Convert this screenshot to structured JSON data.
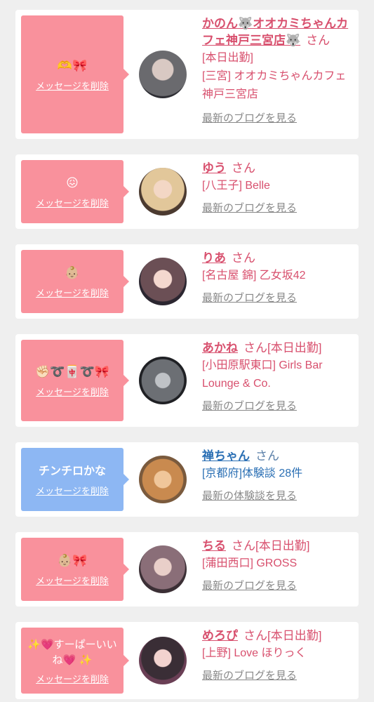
{
  "items": [
    {
      "bubble_message": "🫶🎀",
      "delete_label": "メッセージを削除",
      "name": "かのん🐺オオカミちゃんカフェ神戸三宮店🐺",
      "honorific": "さん",
      "status": "[本日出勤]",
      "shop": "[三宮] オオカミちゃんカフェ神戸三宮店",
      "link": "最新のブログを見る"
    },
    {
      "bubble_message": "😖",
      "delete_label": "メッセージを削除",
      "name": "ゆう",
      "honorific": "さん",
      "status": "",
      "shop": "[八王子] Belle",
      "link": "最新のブログを見る"
    },
    {
      "bubble_message": "👶🏼",
      "delete_label": "メッセージを削除",
      "name": "りあ",
      "honorific": "さん",
      "status": "",
      "shop": "[名古屋 錦] 乙女坂42",
      "link": "最新のブログを見る"
    },
    {
      "bubble_message": "✊🏻➰🀄➰🎀",
      "delete_label": "メッセージを削除",
      "name": "あかね",
      "honorific": "さん",
      "status": "[本日出勤]",
      "shop": "[小田原駅東口] Girls Bar Lounge & Co.",
      "link": "最新のブログを見る"
    },
    {
      "bubble_message": "チンチロかな",
      "delete_label": "メッセージを削除",
      "name": "禅ちゃん",
      "honorific": "さん",
      "status": "",
      "shop": "[京都府]体験談 28件",
      "link": "最新の体験談を見る"
    },
    {
      "bubble_message": "👶🏼🎀",
      "delete_label": "メッセージを削除",
      "name": "ちる",
      "honorific": "さん",
      "status": "[本日出勤]",
      "shop": "[蒲田西口] GROSS",
      "link": "最新のブログを見る"
    },
    {
      "bubble_message": "✨💗すーぱーいいね💗 ✨",
      "delete_label": "メッセージを削除",
      "name": "めろぴ",
      "honorific": "さん",
      "status": "[本日出勤]",
      "shop": "[上野] Love ほりっく",
      "link": "最新のブログを見る"
    }
  ],
  "colors": {
    "background": "#efefef",
    "card": "#ffffff",
    "bubble_pink": "#f9919c",
    "bubble_blue": "#8db7f3",
    "name_pink": "#d8506e",
    "name_blue": "#2a6fb4",
    "link_gray": "#888888"
  }
}
